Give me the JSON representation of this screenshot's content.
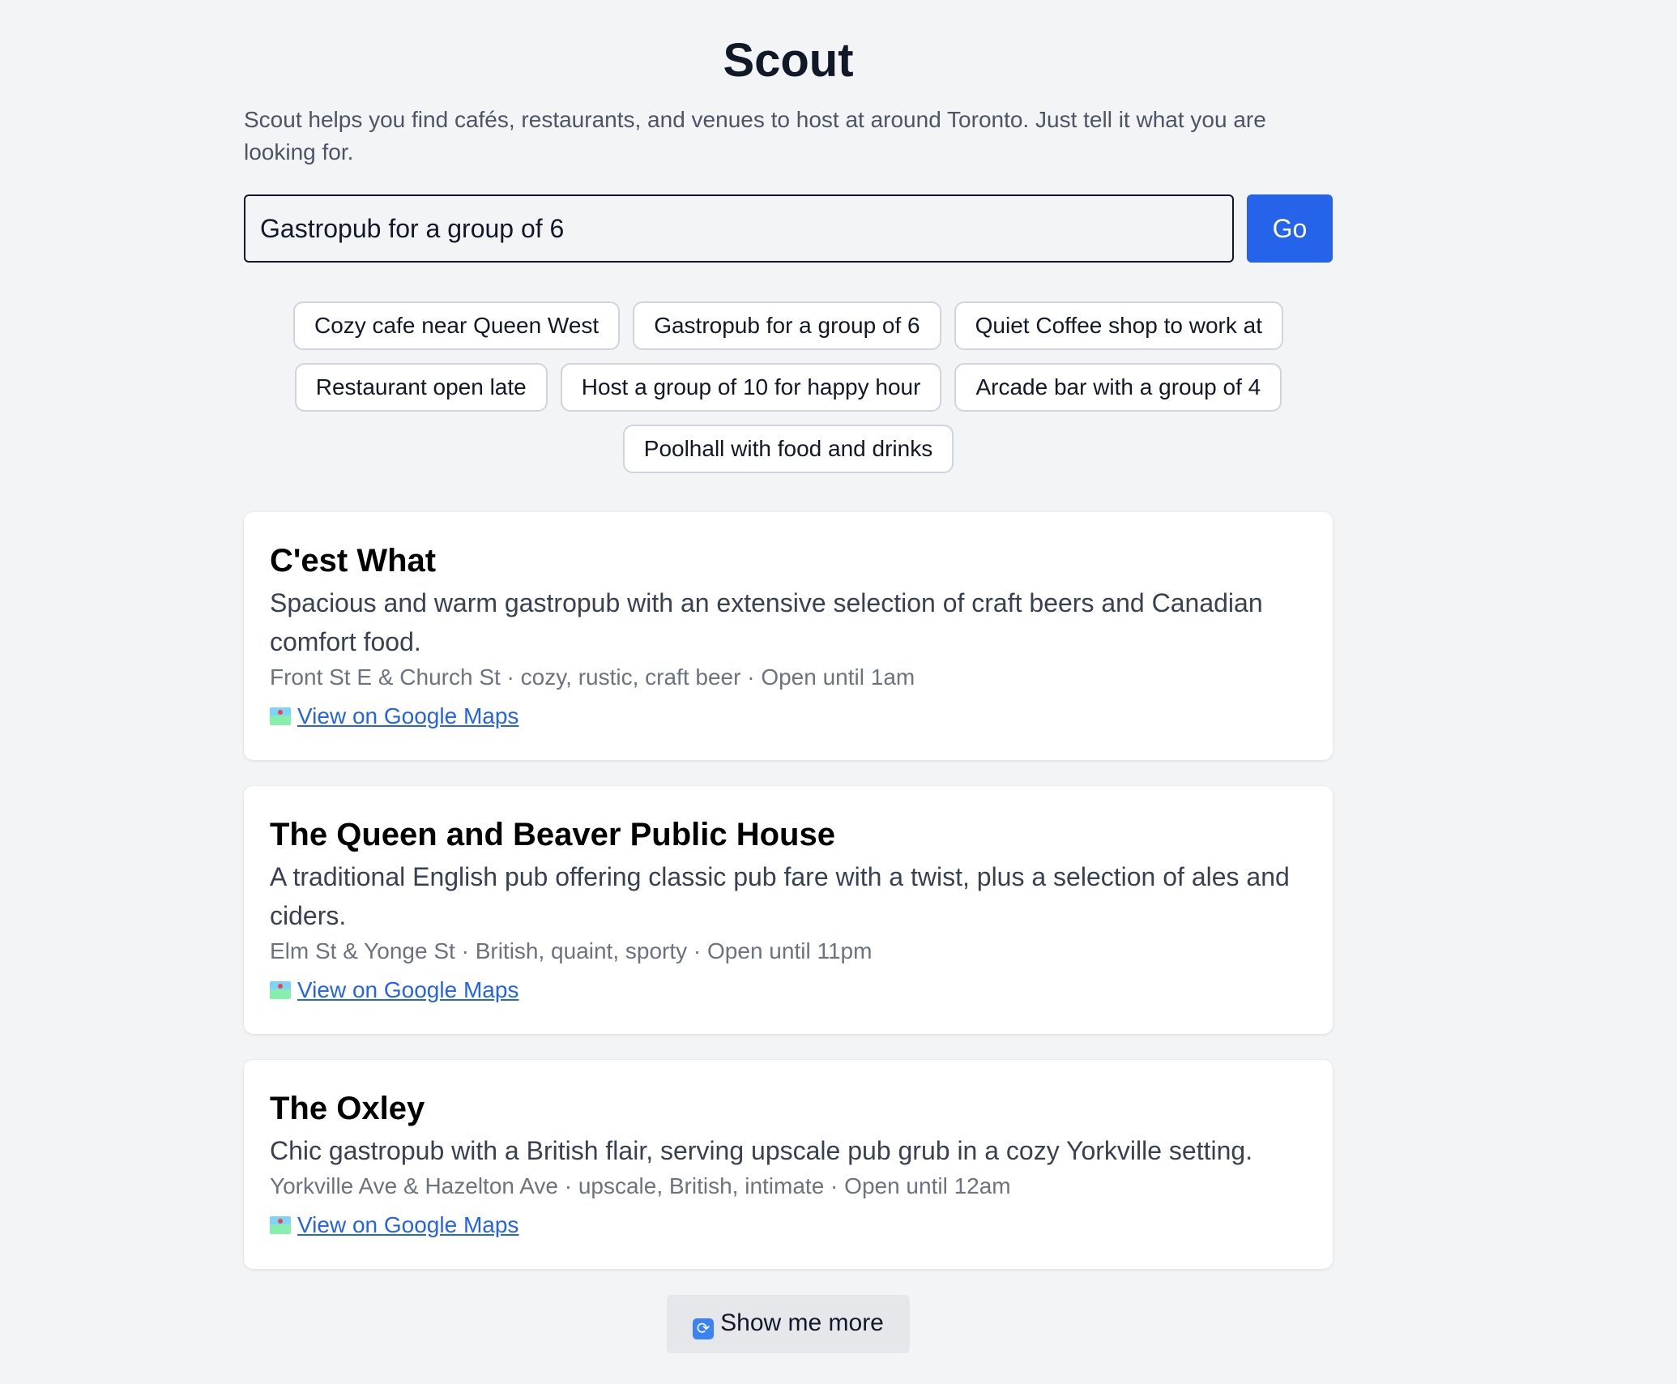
{
  "app": {
    "title": "Scout",
    "subtitle": "Scout helps you find cafés, restaurants, and venues to host at around Toronto. Just tell it what you are looking for."
  },
  "search": {
    "value": "Gastropub for a group of 6",
    "button_label": "Go"
  },
  "suggestions": [
    "Cozy cafe near Queen West",
    "Gastropub for a group of 6",
    "Quiet Coffee shop to work at",
    "Restaurant open late",
    "Host a group of 10 for happy hour",
    "Arcade bar with a group of 4",
    "Poolhall with food and drinks"
  ],
  "results": [
    {
      "name": "C'est What",
      "description": "Spacious and warm gastropub with an extensive selection of craft beers and Canadian comfort food.",
      "meta": "Front St E & Church St · cozy, rustic, craft beer · Open until 1am",
      "link_label": "View on Google Maps",
      "link_icon": "map-icon"
    },
    {
      "name": "The Queen and Beaver Public House",
      "description": "A traditional English pub offering classic pub fare with a twist, plus a selection of ales and ciders.",
      "meta": "Elm St & Yonge St · British, quaint, sporty · Open until 11pm",
      "link_label": "View on Google Maps",
      "link_icon": "map-icon"
    },
    {
      "name": "The Oxley",
      "description": "Chic gastropub with a British flair, serving upscale pub grub in a cozy Yorkville setting.",
      "meta": "Yorkville Ave & Hazelton Ave · upscale, British, intimate · Open until 12am",
      "link_label": "View on Google Maps",
      "link_icon": "map-icon"
    }
  ],
  "more": {
    "label": "Show me more",
    "icon": "refresh-icon"
  },
  "colors": {
    "background": "#f3f4f6",
    "accent": "#2563eb",
    "card": "#ffffff"
  }
}
